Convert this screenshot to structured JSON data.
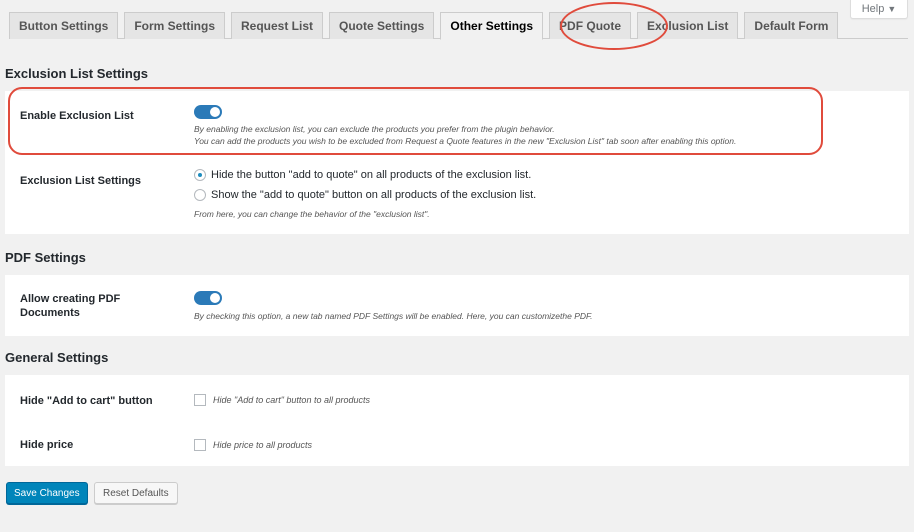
{
  "help": {
    "label": "Help",
    "caret": "▼"
  },
  "tabs": [
    {
      "label": "Button Settings"
    },
    {
      "label": "Form Settings"
    },
    {
      "label": "Request List"
    },
    {
      "label": "Quote Settings"
    },
    {
      "label": "Other Settings",
      "active": true
    },
    {
      "label": "PDF Quote"
    },
    {
      "label": "Exclusion List"
    },
    {
      "label": "Default Form"
    }
  ],
  "exclusion": {
    "section_title": "Exclusion List Settings",
    "enable": {
      "label": "Enable Exclusion List",
      "enabled": true,
      "desc_line1": "By enabling the exclusion list, you can exclude the products you prefer from the plugin behavior.",
      "desc_line2": "You can add the products you wish to be excluded from Request a Quote features in the new \"Exclusion List\" tab soon after enabling this option."
    },
    "behavior": {
      "label": "Exclusion List Settings",
      "option1": "Hide the button \"add to quote\" on all products of the exclusion list.",
      "option2": "Show the \"add to quote\" button on all products of the exclusion list.",
      "selected": "option1",
      "desc": "From here, you can change the behavior of the \"exclusion list\"."
    }
  },
  "pdf": {
    "section_title": "PDF Settings",
    "allow": {
      "label_line1": "Allow creating PDF",
      "label_line2": "Documents",
      "enabled": true,
      "desc": "By checking this option, a new tab named PDF Settings will be enabled. Here, you can customizethe PDF."
    }
  },
  "general": {
    "section_title": "General Settings",
    "hide_cart": {
      "label": "Hide \"Add to cart\" button",
      "checkbox_label": "Hide \"Add to cart\" button to all products",
      "checked": false
    },
    "hide_price": {
      "label": "Hide price",
      "checkbox_label": "Hide price to all products",
      "checked": false
    }
  },
  "actions": {
    "save_label": "Save Changes",
    "reset_label": "Reset Defaults"
  },
  "colors": {
    "accent": "#0085ba",
    "toggle_on": "#2b7ab8",
    "annotation": "#e04b3c"
  }
}
